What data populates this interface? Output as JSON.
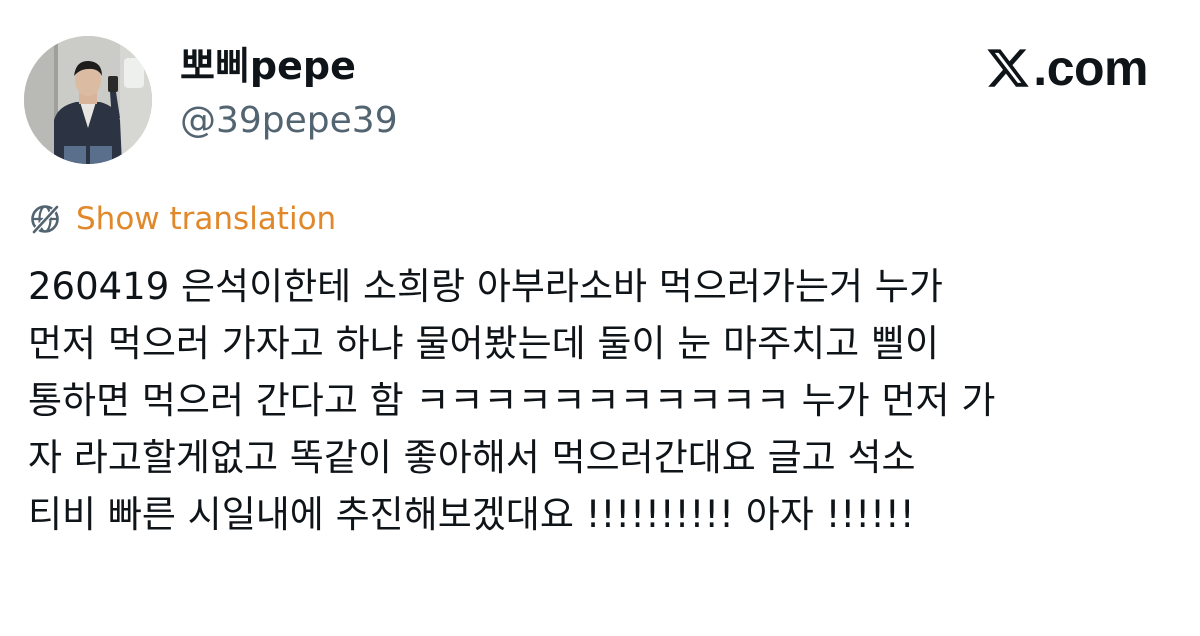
{
  "author": {
    "display_name": "뽀삐pepe",
    "handle": "@39pepe39",
    "avatar_icon": "profile-photo"
  },
  "brand": {
    "x_icon": "x-logo-icon",
    "text": ".com"
  },
  "translation": {
    "icon": "globe-icon",
    "label": "Show translation",
    "color": "#e0882a"
  },
  "tweet": {
    "lines": [
      "260419 은석이한테 소희랑 아부라소바 먹으러가는거 누가",
      "먼저 먹으러 가자고 하냐 물어봤는데 둘이 눈 마주치고 삘이",
      "통하면 먹으러 간다고 함 ㅋㅋㅋㅋㅋㅋㅋㅋㅋㅋㅋ 누가 먼저 가",
      "자 라고할게없고 똑같이 좋아해서 먹으러간대요 글고 석소",
      "티비 빠른 시일내에 추진해보겠대요 !!!!!!!!!! 아자 !!!!!!"
    ]
  },
  "colors": {
    "text_primary": "#0f1419",
    "text_secondary": "#536471",
    "background": "#ffffff"
  }
}
